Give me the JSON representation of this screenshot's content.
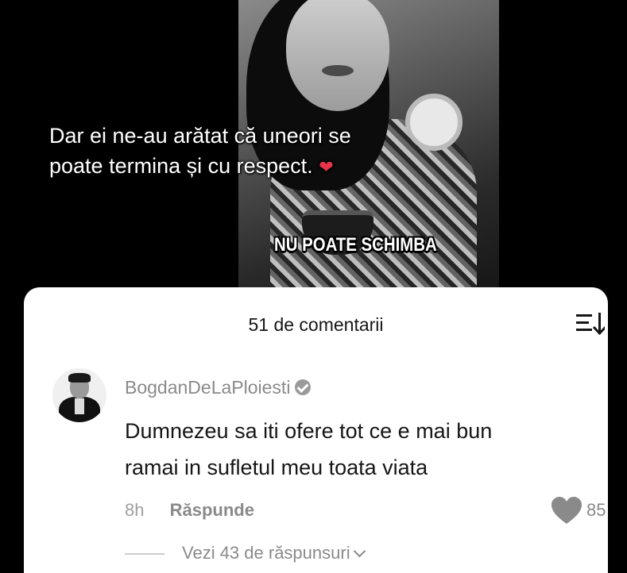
{
  "video": {
    "caption_line1": "Dar ei ne-au arătat că uneori se",
    "caption_line2": "poate termina și cu respect.",
    "caption_emoji": "❤",
    "overlay_text": "NU POATE SCHIMBA"
  },
  "comments_sheet": {
    "title": "51 de comentarii",
    "sort_icon": "sort-icon"
  },
  "comment": {
    "username": "BogdanDeLaPloiesti",
    "verified_icon": "verified-icon",
    "text_line1": "Dumnezeu sa iti ofere tot ce e mai bun",
    "text_line2": "ramai in sufletul meu toata viata",
    "time": "8h",
    "reply_label": "Răspunde",
    "like_icon": "heart-icon",
    "like_count": "85",
    "view_replies": "Vezi 43 de răspunsuri"
  },
  "colors": {
    "sheet_bg": "#ffffff",
    "like_heart": "#8a8a8a",
    "caption_heart": "#e8344a"
  }
}
